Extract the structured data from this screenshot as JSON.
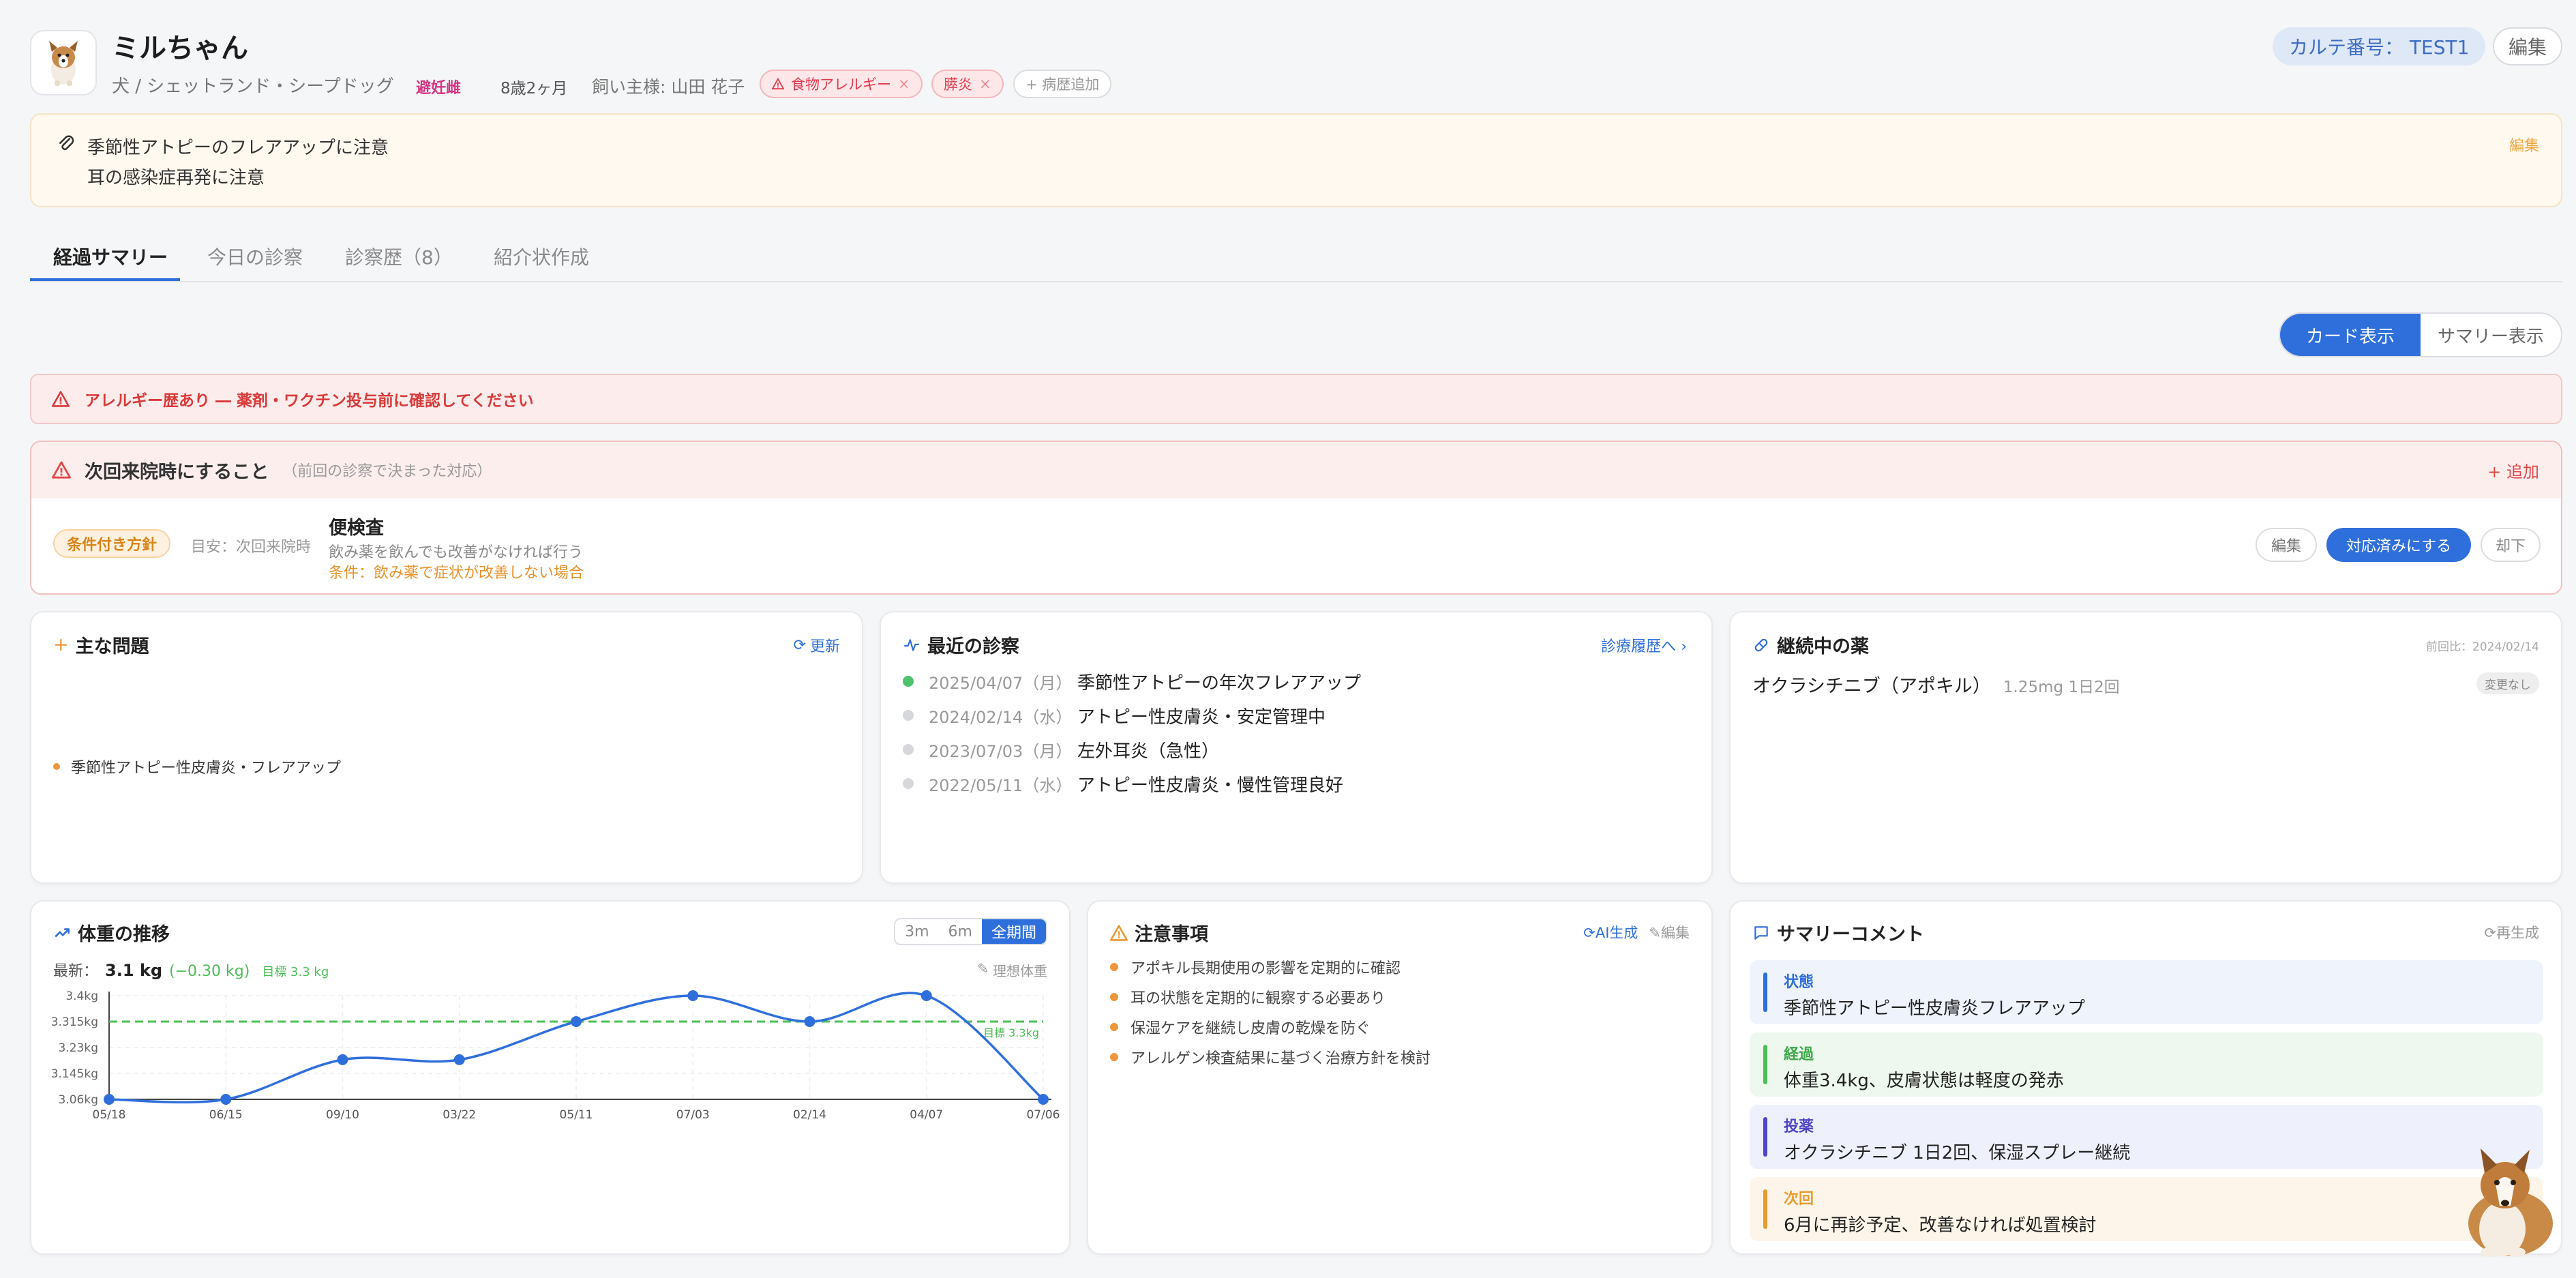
{
  "pet": {
    "name": "ミルちゃん",
    "breed": "犬 / シェットランド・シープドッグ",
    "neutered": "避妊雌",
    "age": "8歳2ヶ月",
    "owner": "飼い主様: 山田 花子",
    "tags": [
      "食物アレルギー",
      "膵炎"
    ],
    "add_history": "+ 病歴追加",
    "chart_number": "カルテ番号： TEST1",
    "edit": "編集"
  },
  "memo": {
    "lines": [
      "季節性アトピーのフレアアップに注意",
      "耳の感染症再発に注意"
    ],
    "edit": "編集"
  },
  "tabs": [
    {
      "label": "経過サマリー",
      "active": true
    },
    {
      "label": "今日の診察",
      "active": false
    },
    {
      "label": "診察歴（8）",
      "active": false
    },
    {
      "label": "紹介状作成",
      "active": false
    }
  ],
  "view_toggle": {
    "card": "カード表示",
    "summary": "サマリー表示"
  },
  "allergy_banner": "アレルギー歴あり ― 薬剤・ワクチン投与前に確認してください",
  "next_visit": {
    "title": "次回来院時にすること",
    "subtitle": "（前回の診察で決まった対応）",
    "add": "+ 追加",
    "badge": "条件付き方針",
    "timing": "目安：次回来院時",
    "item_title": "便検査",
    "item_desc": "飲み薬を飲んでも改善がなければ行う",
    "item_condition": "条件：飲み薬で症状が改善しない場合",
    "buttons": {
      "edit": "編集",
      "done": "対応済みにする",
      "dismiss": "却下"
    }
  },
  "main_issues": {
    "title": "主な問題",
    "refresh": "更新",
    "items": [
      "季節性アトピー性皮膚炎・フレアアップ"
    ]
  },
  "recent_visits": {
    "title": "最近の診察",
    "link": "診療履歴へ",
    "items": [
      {
        "date": "2025/04/07（月）",
        "text": "季節性アトピーの年次フレアアップ",
        "color": "#4cc26a"
      },
      {
        "date": "2024/02/14（水）",
        "text": "アトピー性皮膚炎・安定管理中",
        "color": "#d5d7db"
      },
      {
        "date": "2023/07/03（月）",
        "text": "左外耳炎（急性）",
        "color": "#d5d7db"
      },
      {
        "date": "2022/05/11（水）",
        "text": "アトピー性皮膚炎・慢性管理良好",
        "color": "#d5d7db"
      }
    ]
  },
  "medications": {
    "title": "継続中の薬",
    "compare": "前回比：2024/02/14",
    "items": [
      {
        "name": "オクラシチニブ（アポキル）",
        "dose": "1.25mg 1日2回",
        "status": "変更なし"
      }
    ]
  },
  "weight": {
    "title": "体重の推移",
    "ranges": [
      "3m",
      "6m",
      "全期間"
    ],
    "active_range": "全期間",
    "latest_label": "最新：",
    "latest_value": "3.1 kg",
    "latest_diff": "(−0.30 kg)",
    "target_text": "目標 3.3 kg",
    "ideal_link": "理想体重",
    "target_line_label": "目標 3.3kg"
  },
  "chart_data": {
    "type": "line",
    "title": "体重の推移",
    "xlabel": "",
    "ylabel": "",
    "categories": [
      "05/18",
      "06/15",
      "09/10",
      "03/22",
      "05/11",
      "07/03",
      "02/14",
      "04/07",
      "07/06"
    ],
    "series": [
      {
        "values": [
          3.06,
          3.06,
          3.19,
          3.19,
          3.315,
          3.4,
          3.315,
          3.4,
          3.06
        ]
      }
    ],
    "yticks": [
      "3.4kg",
      "3.315kg",
      "3.23kg",
      "3.145kg",
      "3.06kg"
    ],
    "ylim": [
      3.06,
      3.4
    ],
    "target": 3.315,
    "line_color": "#2f6fdb",
    "target_color": "#4cbf55",
    "grid": true
  },
  "cautions": {
    "title": "注意事項",
    "ai": "AI生成",
    "edit": "編集",
    "items": [
      "アポキル長期使用の影響を定期的に確認",
      "耳の状態を定期的に観察する必要あり",
      "保湿ケアを継続し皮膚の乾燥を防ぐ",
      "アレルゲン検査結果に基づく治療方針を検討"
    ]
  },
  "summary_comment": {
    "title": "サマリーコメント",
    "regen": "再生成",
    "items": [
      {
        "label": "状態",
        "text": "季節性アトピー性皮膚炎フレアアップ",
        "color": "#2f6fdb",
        "bg": "#eef3fc"
      },
      {
        "label": "経過",
        "text": "体重3.4kg、皮膚状態は軽度の発赤",
        "color": "#4cbf55",
        "bg": "#eef8ef"
      },
      {
        "label": "投薬",
        "text": "オクラシチニブ 1日2回、保湿スプレー継続",
        "color": "#4f46c5",
        "bg": "#eef0fb"
      },
      {
        "label": "次回",
        "text": "6月に再診予定、改善なければ処置検討",
        "color": "#e89a2e",
        "bg": "#fdf5e9"
      }
    ]
  }
}
